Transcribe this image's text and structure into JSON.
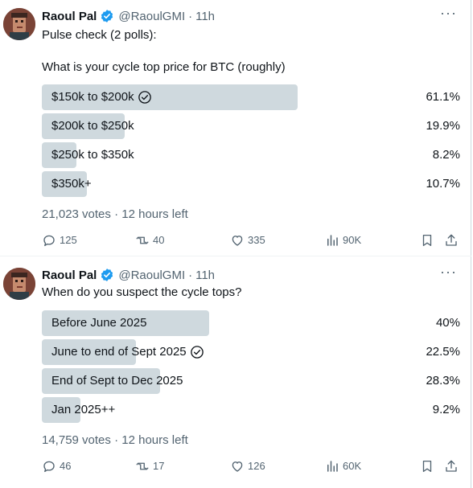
{
  "colors": {
    "bar": "#cfd9de",
    "secondary_text": "#536471",
    "verified": "#1d9bf0"
  },
  "tweets": [
    {
      "author": {
        "name": "Raoul Pal",
        "handle": "@RaoulGMI",
        "separator": "·",
        "time": "11h"
      },
      "intro": "Pulse check (2 polls):",
      "question": "What is your cycle top price for BTC (roughly)",
      "options": [
        {
          "label": "$150k to $200k",
          "pct": "61.1%",
          "share": 61.1,
          "winner": true
        },
        {
          "label": "$200k to $250k",
          "pct": "19.9%",
          "share": 19.9,
          "winner": false
        },
        {
          "label": "$250k to $350k",
          "pct": "8.2%",
          "share": 8.2,
          "winner": false
        },
        {
          "label": "$350k+",
          "pct": "10.7%",
          "share": 10.7,
          "winner": false
        }
      ],
      "votes": "21,023 votes",
      "time_left": "12 hours left",
      "stats": {
        "replies": "125",
        "retweets": "40",
        "likes": "335",
        "views": "90K"
      }
    },
    {
      "author": {
        "name": "Raoul Pal",
        "handle": "@RaoulGMI",
        "separator": "·",
        "time": "11h"
      },
      "question": "When do you suspect the cycle tops?",
      "options": [
        {
          "label": "Before June 2025",
          "pct": "40%",
          "share": 40,
          "winner": false
        },
        {
          "label": "June to end of Sept 2025",
          "pct": "22.5%",
          "share": 22.5,
          "winner": true
        },
        {
          "label": "End of Sept to Dec 2025",
          "pct": "28.3%",
          "share": 28.3,
          "winner": false
        },
        {
          "label": "Jan 2025++",
          "pct": "9.2%",
          "share": 9.2,
          "winner": false
        }
      ],
      "votes": "14,759 votes",
      "time_left": "12 hours left",
      "stats": {
        "replies": "46",
        "retweets": "17",
        "likes": "126",
        "views": "60K"
      }
    }
  ],
  "icons": {
    "more": "more-dots-icon",
    "verified": "verified-badge-icon",
    "check": "check-circle-icon",
    "reply": "reply-icon",
    "retweet": "retweet-icon",
    "like": "heart-icon",
    "views": "views-icon",
    "bookmark": "bookmark-icon",
    "share": "share-icon"
  }
}
